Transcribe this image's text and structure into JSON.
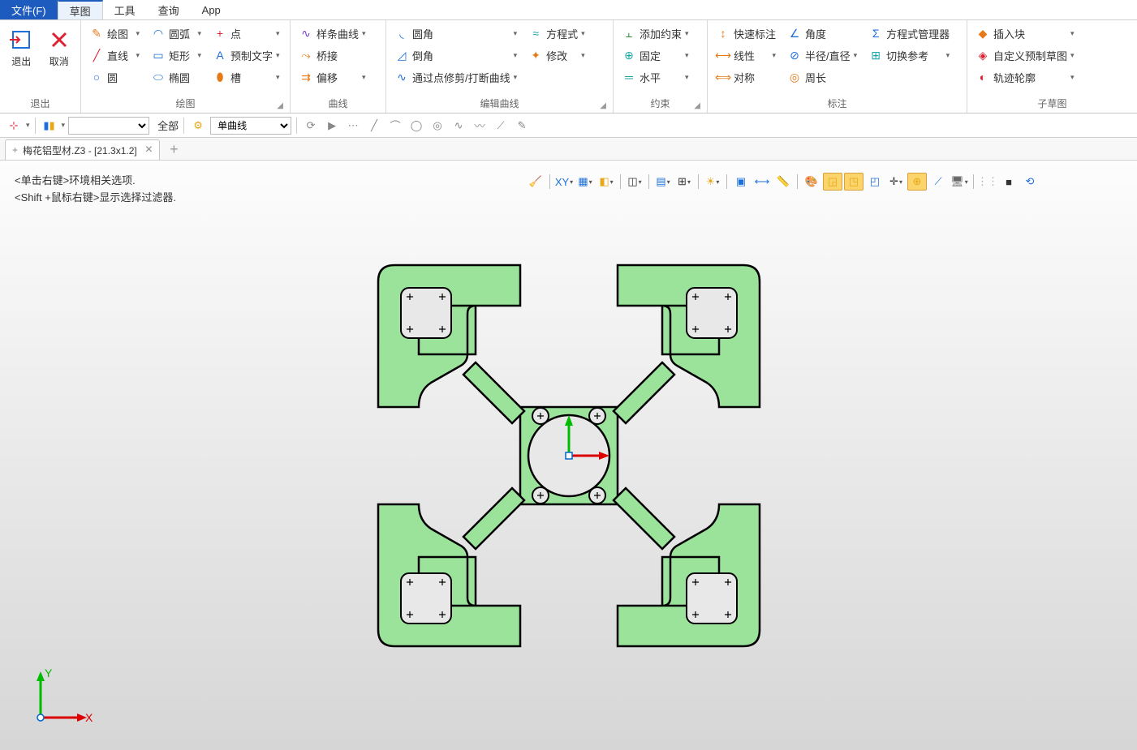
{
  "menu": {
    "file": "文件(F)",
    "tabs": [
      "草图",
      "工具",
      "查询",
      "App"
    ],
    "active": 0
  },
  "ribbon": {
    "exit": {
      "exit": "退出",
      "cancel": "取消",
      "title": "退出"
    },
    "draw": {
      "title": "绘图",
      "items": [
        {
          "label": "绘图",
          "icon": "✎",
          "cls": "orange",
          "dd": true
        },
        {
          "label": "直线",
          "icon": "╱",
          "cls": "red",
          "dd": true
        },
        {
          "label": "圆",
          "icon": "○",
          "cls": "blue",
          "dd": false
        },
        {
          "label": "圆弧",
          "icon": "◠",
          "cls": "blue",
          "dd": true
        },
        {
          "label": "矩形",
          "icon": "▭",
          "cls": "blue",
          "dd": true
        },
        {
          "label": "椭圆",
          "icon": "⬭",
          "cls": "blue",
          "dd": false
        },
        {
          "label": "点",
          "icon": "+",
          "cls": "red",
          "dd": true
        },
        {
          "label": "预制文字",
          "icon": "A",
          "cls": "blue",
          "dd": true
        },
        {
          "label": "槽",
          "icon": "⬮",
          "cls": "orange",
          "dd": true
        }
      ]
    },
    "curve": {
      "title": "曲线",
      "items": [
        {
          "label": "样条曲线",
          "icon": "∿",
          "cls": "purple",
          "dd": true
        },
        {
          "label": "桥接",
          "icon": "⤳",
          "cls": "orange",
          "dd": false
        },
        {
          "label": "偏移",
          "icon": "⇉",
          "cls": "orange",
          "dd": true
        }
      ]
    },
    "editcurve": {
      "title": "编辑曲线",
      "items": [
        {
          "label": "圆角",
          "icon": "◟",
          "cls": "blue",
          "dd": true
        },
        {
          "label": "倒角",
          "icon": "◿",
          "cls": "blue",
          "dd": true
        },
        {
          "label": "通过点修剪/打断曲线",
          "icon": "∿",
          "cls": "blue",
          "dd": true
        },
        {
          "label": "方程式",
          "icon": "≈",
          "cls": "teal",
          "dd": true
        },
        {
          "label": "修改",
          "icon": "✦",
          "cls": "orange",
          "dd": true
        }
      ]
    },
    "constraint": {
      "title": "约束",
      "items": [
        {
          "label": "添加约束",
          "icon": "⫠",
          "cls": "green",
          "dd": true
        },
        {
          "label": "固定",
          "icon": "⊕",
          "cls": "teal",
          "dd": true
        },
        {
          "label": "水平",
          "icon": "═",
          "cls": "teal",
          "dd": true
        }
      ]
    },
    "dim": {
      "title": "标注",
      "items": [
        {
          "label": "快速标注",
          "icon": "↕",
          "cls": "orange",
          "dd": false
        },
        {
          "label": "线性",
          "icon": "⟷",
          "cls": "orange",
          "dd": true
        },
        {
          "label": "对称",
          "icon": "⟺",
          "cls": "orange",
          "dd": false
        },
        {
          "label": "角度",
          "icon": "∠",
          "cls": "blue",
          "dd": false
        },
        {
          "label": "半径/直径",
          "icon": "⊘",
          "cls": "blue",
          "dd": true
        },
        {
          "label": "周长",
          "icon": "◎",
          "cls": "orange",
          "dd": false
        },
        {
          "label": "方程式管理器",
          "icon": "Σ",
          "cls": "blue",
          "dd": false
        },
        {
          "label": "切换参考",
          "icon": "⊞",
          "cls": "teal",
          "dd": true
        }
      ]
    },
    "subsketch": {
      "title": "子草图",
      "items": [
        {
          "label": "插入块",
          "icon": "◆",
          "cls": "orange",
          "dd": true
        },
        {
          "label": "自定义预制草图",
          "icon": "◈",
          "cls": "red",
          "dd": true
        },
        {
          "label": "轨迹轮廓",
          "icon": "◐",
          "cls": "red",
          "dd": true
        }
      ]
    }
  },
  "quickbar": {
    "all": "全部",
    "filter": "单曲线"
  },
  "doctab": {
    "title": "梅花铝型材.Z3 - [21.3x1.2]"
  },
  "hints": {
    "l1": "<单击右键>环境相关选项.",
    "l2": "<Shift +鼠标右键>显示选择过滤器."
  },
  "axes": {
    "x": "X",
    "y": "Y"
  }
}
